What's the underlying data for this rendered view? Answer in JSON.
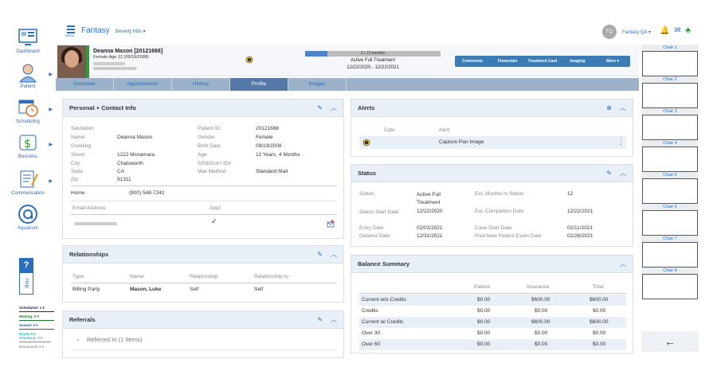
{
  "sidebar": {
    "items": [
      {
        "label": "Dashboard",
        "icon": "dashboard-icon"
      },
      {
        "label": "Patient",
        "icon": "patient-icon"
      },
      {
        "label": "Scheduling",
        "icon": "scheduling-icon"
      },
      {
        "label": "Business",
        "icon": "business-icon"
      },
      {
        "label": "Communication",
        "icon": "communication-icon"
      },
      {
        "label": "Aquarium",
        "icon": "aquarium-icon"
      }
    ],
    "help": "?",
    "help_tab": "Help",
    "queues": [
      {
        "label": "Scheduled: 1 ▾",
        "color": "#1a2a6c"
      },
      {
        "label": "Waiting: 0 ▾",
        "color": "#1d7a2c"
      },
      {
        "label": "Seated: 0 ▾",
        "color": "#1d63b8"
      },
      {
        "label": "Ready for Checkout: 0 ▾",
        "color": "#2fb6c9"
      },
      {
        "label": "Dismissed: 0 ▾",
        "color": "#999999"
      }
    ]
  },
  "topbar": {
    "menu_label": "MENU",
    "app_title": "Fantasy",
    "location": "Beverly Hills ▾",
    "user_initials": "FQ",
    "user_name": "Fantasy QA ▾"
  },
  "patient": {
    "name": "Deanna Mason [20121668]",
    "info": "Female Age 12 (09/19/2008)",
    "progress_text": "2 / 12 months",
    "progress_fraction": 0.1667,
    "treatment_status": "Active Full Treatment",
    "treatment_dates": "12/22/2020 - 12/22/2021",
    "actions": [
      "Comments",
      "Financials",
      "Treatment Card",
      "Imaging",
      "More ▾"
    ]
  },
  "tabs": [
    "Overview",
    "Appointments",
    "History",
    "Profile",
    "Images"
  ],
  "personal": {
    "title": "Personal + Contact Info",
    "left_fields": [
      {
        "label": "Salutation",
        "value": ""
      },
      {
        "label": "Name",
        "value": "Deanna Mason"
      },
      {
        "label": "Greeting",
        "value": ""
      },
      {
        "label": "Street",
        "value": "1222 Mcnamara"
      },
      {
        "label": "City",
        "value": "Chatsworth"
      },
      {
        "label": "State",
        "value": "CA"
      },
      {
        "label": "Zip",
        "value": "91311"
      }
    ],
    "right_fields": [
      {
        "label": "Patient ID",
        "value": "20121668"
      },
      {
        "label": "Gender",
        "value": "Female"
      },
      {
        "label": "Birth Date",
        "value": "09/19/2008"
      },
      {
        "label": "Age",
        "value": "12 Years, 4 Months"
      },
      {
        "label": "SSN/Gov't ID#",
        "value": ""
      },
      {
        "label": "Mail Method",
        "value": "Standard Mail"
      }
    ],
    "phone_label": "Home",
    "phone_value": "(800) 548-7241",
    "email_header": "Email Address",
    "appt_header": "Appt",
    "appt_check": "✓"
  },
  "relationships": {
    "title": "Relationships",
    "headers": [
      "Type",
      "Name",
      "Relationship",
      "Relationship to"
    ],
    "row": [
      "Billing Party",
      "Mason, Luke",
      "Self",
      "Self"
    ]
  },
  "referrals": {
    "title": "Referrals",
    "referred_in": "Referred In (1 Items)"
  },
  "alerts": {
    "title": "Alerts",
    "headers": [
      "Date",
      "Alert"
    ],
    "row_alert": "Capture Pan Image"
  },
  "status": {
    "title": "Status",
    "status_label": "Status",
    "status_value": "Active Full Treatment",
    "start_label": "Status Start Date",
    "start_value": "12/22/2020",
    "entry_label": "Entry Date",
    "entry_value": "02/01/2021",
    "deband_label": "Deband Date",
    "deband_value": "12/31/2021",
    "months_label": "Est. Months in Status",
    "months_value": "12",
    "completion_label": "Est. Completion Date",
    "completion_value": "12/22/2021",
    "case_label": "Case Start Date",
    "case_value": "02/11/2021",
    "newexam_label": "Post New Patient Exam Date",
    "newexam_value": "02/28/2021"
  },
  "balance": {
    "title": "Balance Summary",
    "headers": [
      "Patient",
      "Insurance",
      "Total"
    ],
    "rows": [
      {
        "label": "Current w/o Credits",
        "patient": "$0.00",
        "insurance": "$600.00",
        "total": "$600.00"
      },
      {
        "label": "Credits",
        "patient": "$0.00",
        "insurance": "$0.00",
        "total": "$0.00"
      },
      {
        "label": "Current w/ Credits",
        "patient": "$0.00",
        "insurance": "$600.00",
        "total": "$600.00"
      },
      {
        "label": "Over 30",
        "patient": "$0.00",
        "insurance": "$0.00",
        "total": "$0.00"
      },
      {
        "label": "Over 60",
        "patient": "$0.00",
        "insurance": "$0.00",
        "total": "$0.00"
      }
    ]
  },
  "chairs": [
    "Chair 1",
    "Chair 2",
    "Chair 3",
    "Chair 4",
    "Chair 5",
    "Chair 6",
    "Chair 7",
    "Chair 8"
  ],
  "back_arrow": "←",
  "colors": {
    "accent": "#2a6ebb",
    "tab_active": "#5579a7",
    "action_bar": "#3c7cb5",
    "progress_fill": "#4e82c9",
    "card_header": "#e8eff6"
  }
}
